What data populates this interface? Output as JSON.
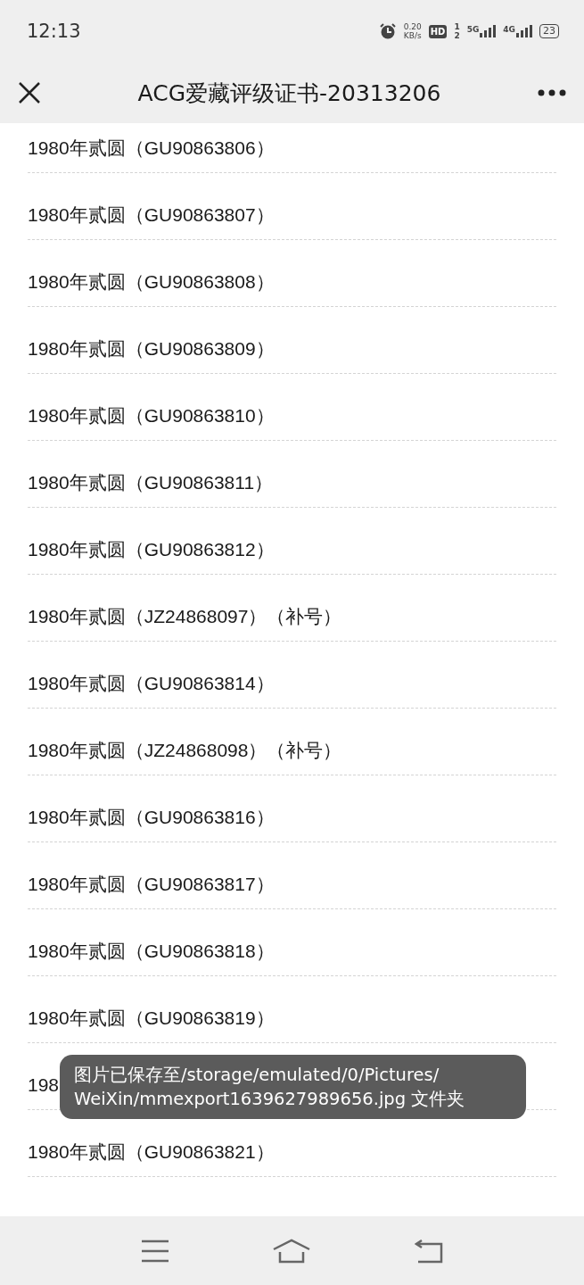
{
  "status_bar": {
    "time": "12:13",
    "net_speed": "0.20",
    "net_unit": "KB/s",
    "hd": "HD",
    "sim_1": "1",
    "sim_2": "2",
    "signal_1": "5G",
    "signal_2": "4G",
    "battery": "23"
  },
  "nav": {
    "title": "ACG爱藏评级证书-20313206"
  },
  "rows": [
    {
      "text": "1980年贰圆（GU90863806）"
    },
    {
      "text": "1980年贰圆（GU90863807）"
    },
    {
      "text": "1980年贰圆（GU90863808）"
    },
    {
      "text": "1980年贰圆（GU90863809）"
    },
    {
      "text": "1980年贰圆（GU90863810）"
    },
    {
      "text": "1980年贰圆（GU90863811）"
    },
    {
      "text": "1980年贰圆（GU90863812）"
    },
    {
      "text": "1980年贰圆（JZ24868097）（补号）"
    },
    {
      "text": "1980年贰圆（GU90863814）"
    },
    {
      "text": "1980年贰圆（JZ24868098）（补号）"
    },
    {
      "text": "1980年贰圆（GU90863816）"
    },
    {
      "text": "1980年贰圆（GU90863817）"
    },
    {
      "text": "1980年贰圆（GU90863818）"
    },
    {
      "text": "1980年贰圆（GU90863819）"
    },
    {
      "text": "198"
    },
    {
      "text": "1980年贰圆（GU90863821）"
    }
  ],
  "toast": {
    "lines": [
      "图片已保存至/storage/emulated/0/Pictures/",
      "WeiXin/mmexport1639627989656.jpg 文件夹"
    ]
  }
}
